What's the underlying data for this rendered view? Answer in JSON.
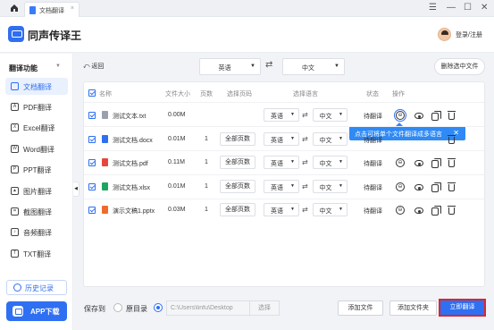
{
  "titlebar": {
    "tab_label": "文档翻译",
    "tab_close": "×",
    "menu_glyph": "☰",
    "minimize_glyph": "—",
    "maximize_glyph": "☐",
    "close_glyph": "✕"
  },
  "header": {
    "app_title": "同声传译王",
    "login": "登录/注册"
  },
  "sidebar": {
    "section_title": "翻译功能",
    "section_arrow": "▼",
    "items": [
      {
        "label": "文档翻译",
        "icon": "document-icon",
        "glyph": "",
        "active": true
      },
      {
        "label": "PDF翻译",
        "icon": "pdf-icon",
        "glyph": "A",
        "active": false
      },
      {
        "label": "Excel翻译",
        "icon": "excel-icon",
        "glyph": "X",
        "active": false
      },
      {
        "label": "Word翻译",
        "icon": "word-icon",
        "glyph": "W",
        "active": false
      },
      {
        "label": "PPT翻译",
        "icon": "ppt-icon",
        "glyph": "P",
        "active": false
      },
      {
        "label": "图片翻译",
        "icon": "image-icon",
        "glyph": "▲",
        "active": false
      },
      {
        "label": "截图翻译",
        "icon": "screenshot-icon",
        "glyph": "⌗",
        "active": false
      },
      {
        "label": "音频翻译",
        "icon": "audio-icon",
        "glyph": "♪",
        "active": false
      },
      {
        "label": "TXT翻译",
        "icon": "txt-icon",
        "glyph": "T",
        "active": false
      }
    ],
    "history": "历史记录",
    "app_download": "APP下载",
    "collapse_glyph": "◀"
  },
  "toolbar": {
    "back": "⤺ 返回",
    "source_lang": "英语",
    "target_lang": "中文",
    "caret": "▼",
    "swap": "⇄",
    "delete_selected": "删除选中文件"
  },
  "table": {
    "headers": {
      "name": "名称",
      "size": "文件大小",
      "pages": "页数",
      "page_select": "选择页码",
      "language": "选择语言",
      "status": "状态",
      "actions": "操作"
    },
    "rows": [
      {
        "name": "测试文本.txt",
        "type": "txt",
        "size": "0.00M",
        "pages": "",
        "page_button": "",
        "source": "英语",
        "target": "中文",
        "status": "待翻译"
      },
      {
        "name": "测试文档.docx",
        "type": "docx",
        "size": "0.01M",
        "pages": "1",
        "page_button": "全部页数",
        "source": "英语",
        "target": "中文",
        "status": "待翻译"
      },
      {
        "name": "测试文档.pdf",
        "type": "pdf",
        "size": "0.11M",
        "pages": "1",
        "page_button": "全部页数",
        "source": "英语",
        "target": "中文",
        "status": "待翻译"
      },
      {
        "name": "测试文档.xlsx",
        "type": "xlsx",
        "size": "0.01M",
        "pages": "1",
        "page_button": "全部页数",
        "source": "英语",
        "target": "中文",
        "status": "待翻译"
      },
      {
        "name": "演示文稿1.pptx",
        "type": "pptx",
        "size": "0.03M",
        "pages": "1",
        "page_button": "全部页数",
        "source": "英语",
        "target": "中文",
        "status": "待翻译"
      }
    ],
    "caret": "▼",
    "swap": "⇄",
    "action_glyph": "⊖"
  },
  "tooltip": {
    "text": "点击可将单个文件翻译成多语言",
    "close": "✕"
  },
  "footer": {
    "save_to": "保存到",
    "original_dir": "原目录",
    "path_value": "C:\\Users\\linfu\\Desktop",
    "choose": "选择",
    "add_file": "添加文件",
    "add_folder": "添加文件夹",
    "start": "立即翻译"
  },
  "colors": {
    "accent": "#2f6ff2",
    "tooltip": "#2f8af5",
    "highlight_border": "#e0242b"
  }
}
